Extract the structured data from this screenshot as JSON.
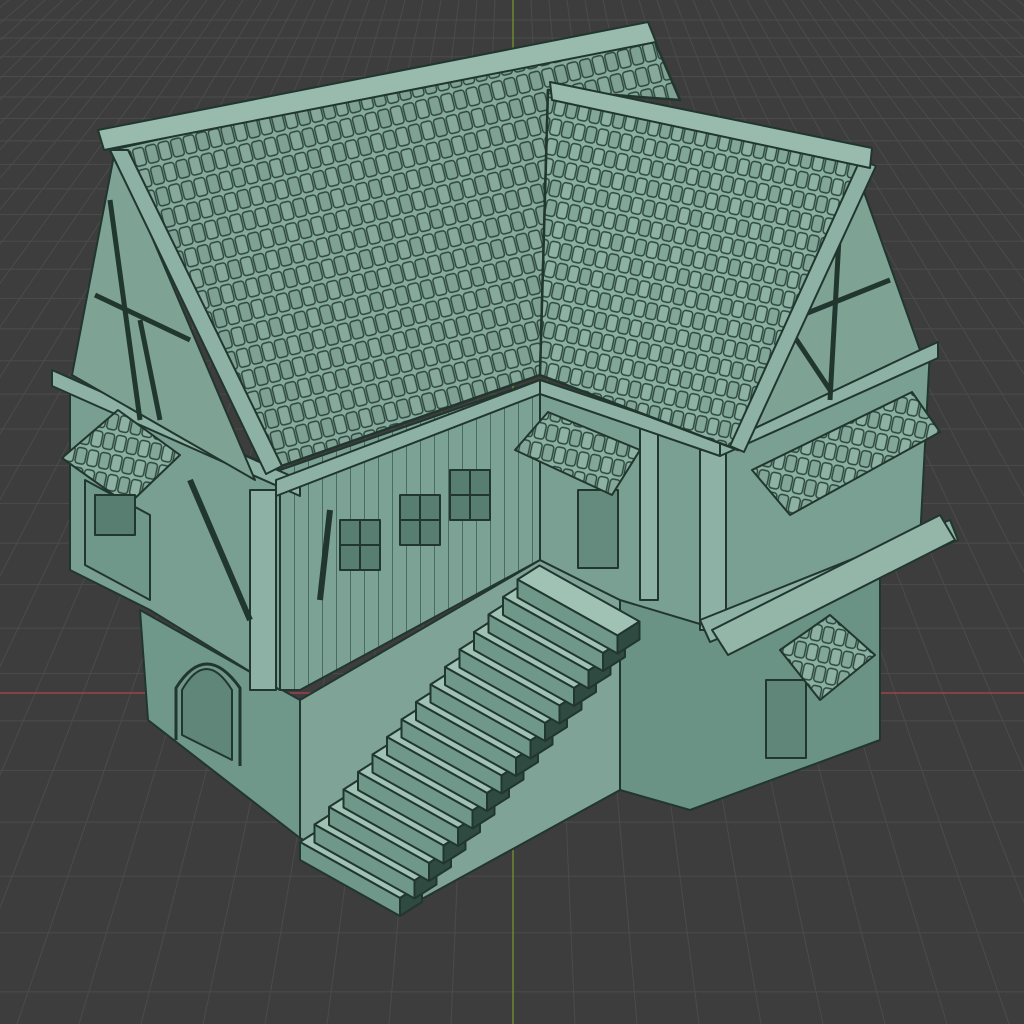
{
  "viewport": {
    "colors": {
      "background": "#3d3d3d",
      "grid_line": "#4b4b4b",
      "x_axis": "#b2434f",
      "y_axis": "#7d9a2a",
      "model_light": "#8fb3a6",
      "model_mid": "#6f978a",
      "model_dark": "#4f7266",
      "edge": "#223630"
    },
    "model": {
      "type": "medieval-house-3d-model",
      "parts": [
        "tiled-roof-left",
        "tiled-roof-right",
        "half-timbered-upper-floor",
        "stone-ground-floor",
        "exterior-staircase",
        "arched-doorway",
        "side-door",
        "window-awnings",
        "balcony"
      ]
    }
  }
}
